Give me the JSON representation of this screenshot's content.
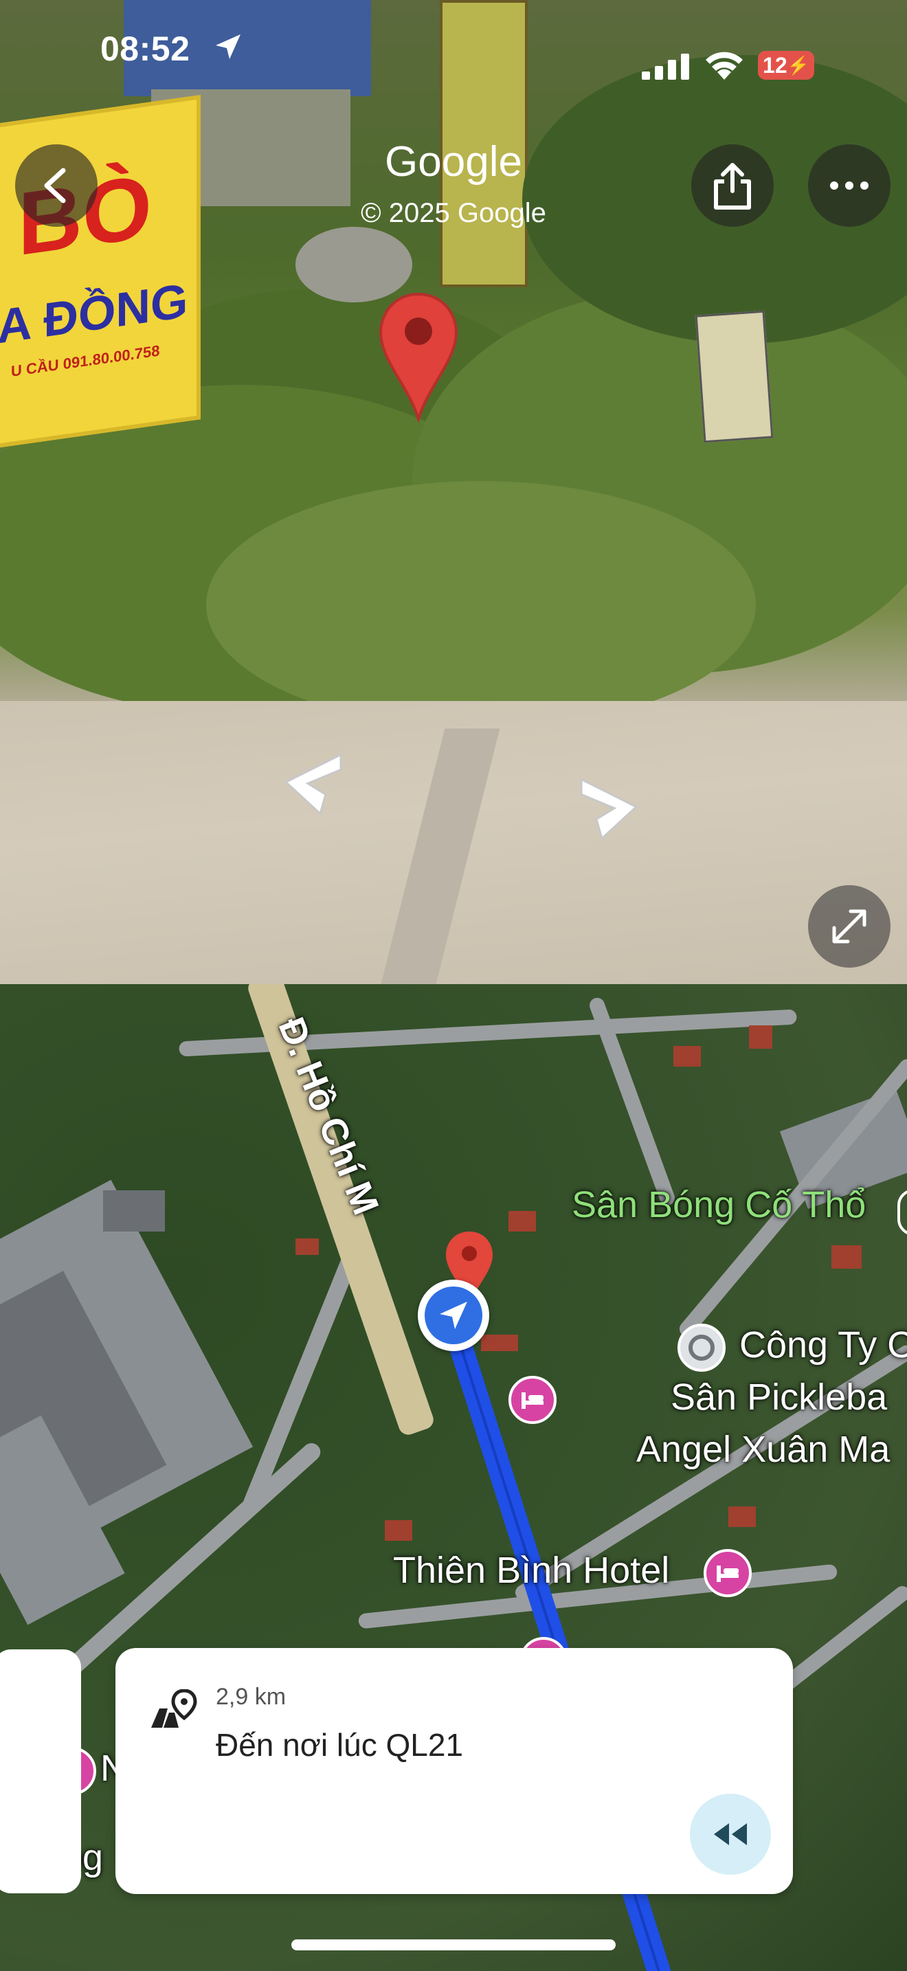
{
  "status_bar": {
    "time": "08:52",
    "battery_level": "12",
    "icons": [
      "location-arrow-icon",
      "signal-icon",
      "wifi-icon",
      "battery-charging-icon"
    ]
  },
  "street_view": {
    "wordmark": "Google",
    "copyright": "© 2025 Google",
    "sign_texts": [
      "BÒ",
      "A ĐỒNG",
      "U CẦU  091.80.00.758"
    ]
  },
  "map": {
    "labels": {
      "road": "Đ. Hồ Chí M",
      "field": "Sân Bóng Cố Thổ",
      "company": "Công Ty C",
      "pickleball_1": "Sân Pickleba",
      "pickleball_2": "Angel Xuân Ma",
      "hotel": "Thiên Bình Hotel",
      "partial_left": "N",
      "partial_google": "og"
    },
    "colors": {
      "route": "#1f4fe6",
      "poi_pink": "#d743a3",
      "green_label": "#8fe07a"
    }
  },
  "card": {
    "distance": "2,9 km",
    "title": "Đến nơi lúc QL21"
  }
}
